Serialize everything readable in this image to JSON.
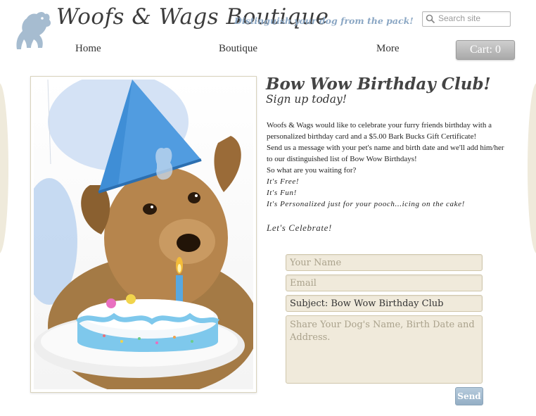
{
  "header": {
    "brand": "Woofs & Wags Boutique",
    "tagline": "Distinguish your dog from the pack!",
    "search": {
      "placeholder": "Search site",
      "value": ""
    },
    "cart_label": "Cart: 0"
  },
  "nav": {
    "home": "Home",
    "boutique": "Boutique",
    "more": "More"
  },
  "article": {
    "title": "Bow Wow Birthday Club!",
    "subtitle": "Sign up today!",
    "line1": "Woofs & Wags would like to celebrate your furry friends birthday with a personalized birthday card and a $5.00 Bark Bucks Gift Certificate!",
    "line2": "Send us a message with your pet's name and birth date and we'll add him/her to our distinguished list of Bow Wow Birthdays!",
    "line3": "So what are you waiting for?",
    "line4": "It's Free!",
    "line5": "It's Fun!",
    "line6": "It's Personalized just for your pooch...icing on the cake!",
    "closing": "Let's Celebrate!"
  },
  "form": {
    "name_placeholder": "Your Name",
    "email_placeholder": "Email",
    "subject_value": "Subject: Bow Wow Birthday Club",
    "message_placeholder": "Share Your Dog's Name, Birth Date and Address.",
    "send_label": "Send"
  },
  "colors": {
    "accent_blue": "#8ba7c4",
    "field_bg": "#f0eadb",
    "cart_gray": "#b8b8b8"
  }
}
